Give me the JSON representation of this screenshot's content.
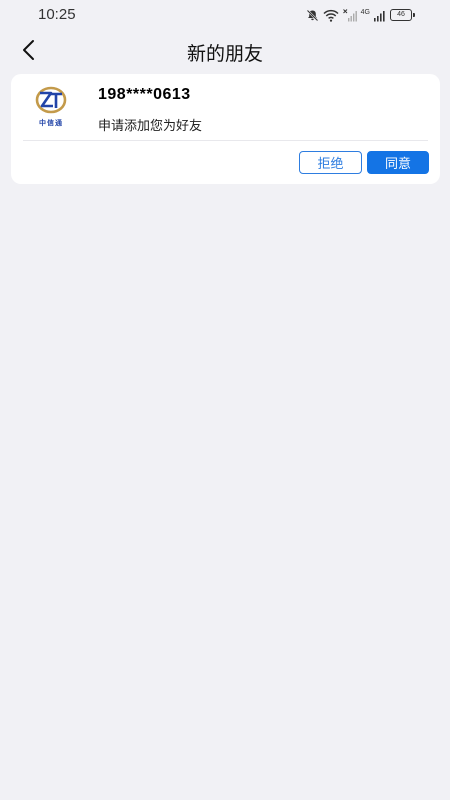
{
  "status_bar": {
    "time": "10:25",
    "network_label": "4G",
    "battery_level": "46"
  },
  "header": {
    "title": "新的朋友",
    "back_icon": "chevron-left-icon"
  },
  "friend_request": {
    "avatar_label": "中信通",
    "phone": "198****0613",
    "message": "申请添加您为好友",
    "reject_label": "拒绝",
    "accept_label": "同意"
  },
  "colors": {
    "background": "#f1f1f5",
    "card": "#ffffff",
    "accent": "#1474e5",
    "avatar_gold": "#c39a4a",
    "avatar_blue": "#2244a8"
  }
}
